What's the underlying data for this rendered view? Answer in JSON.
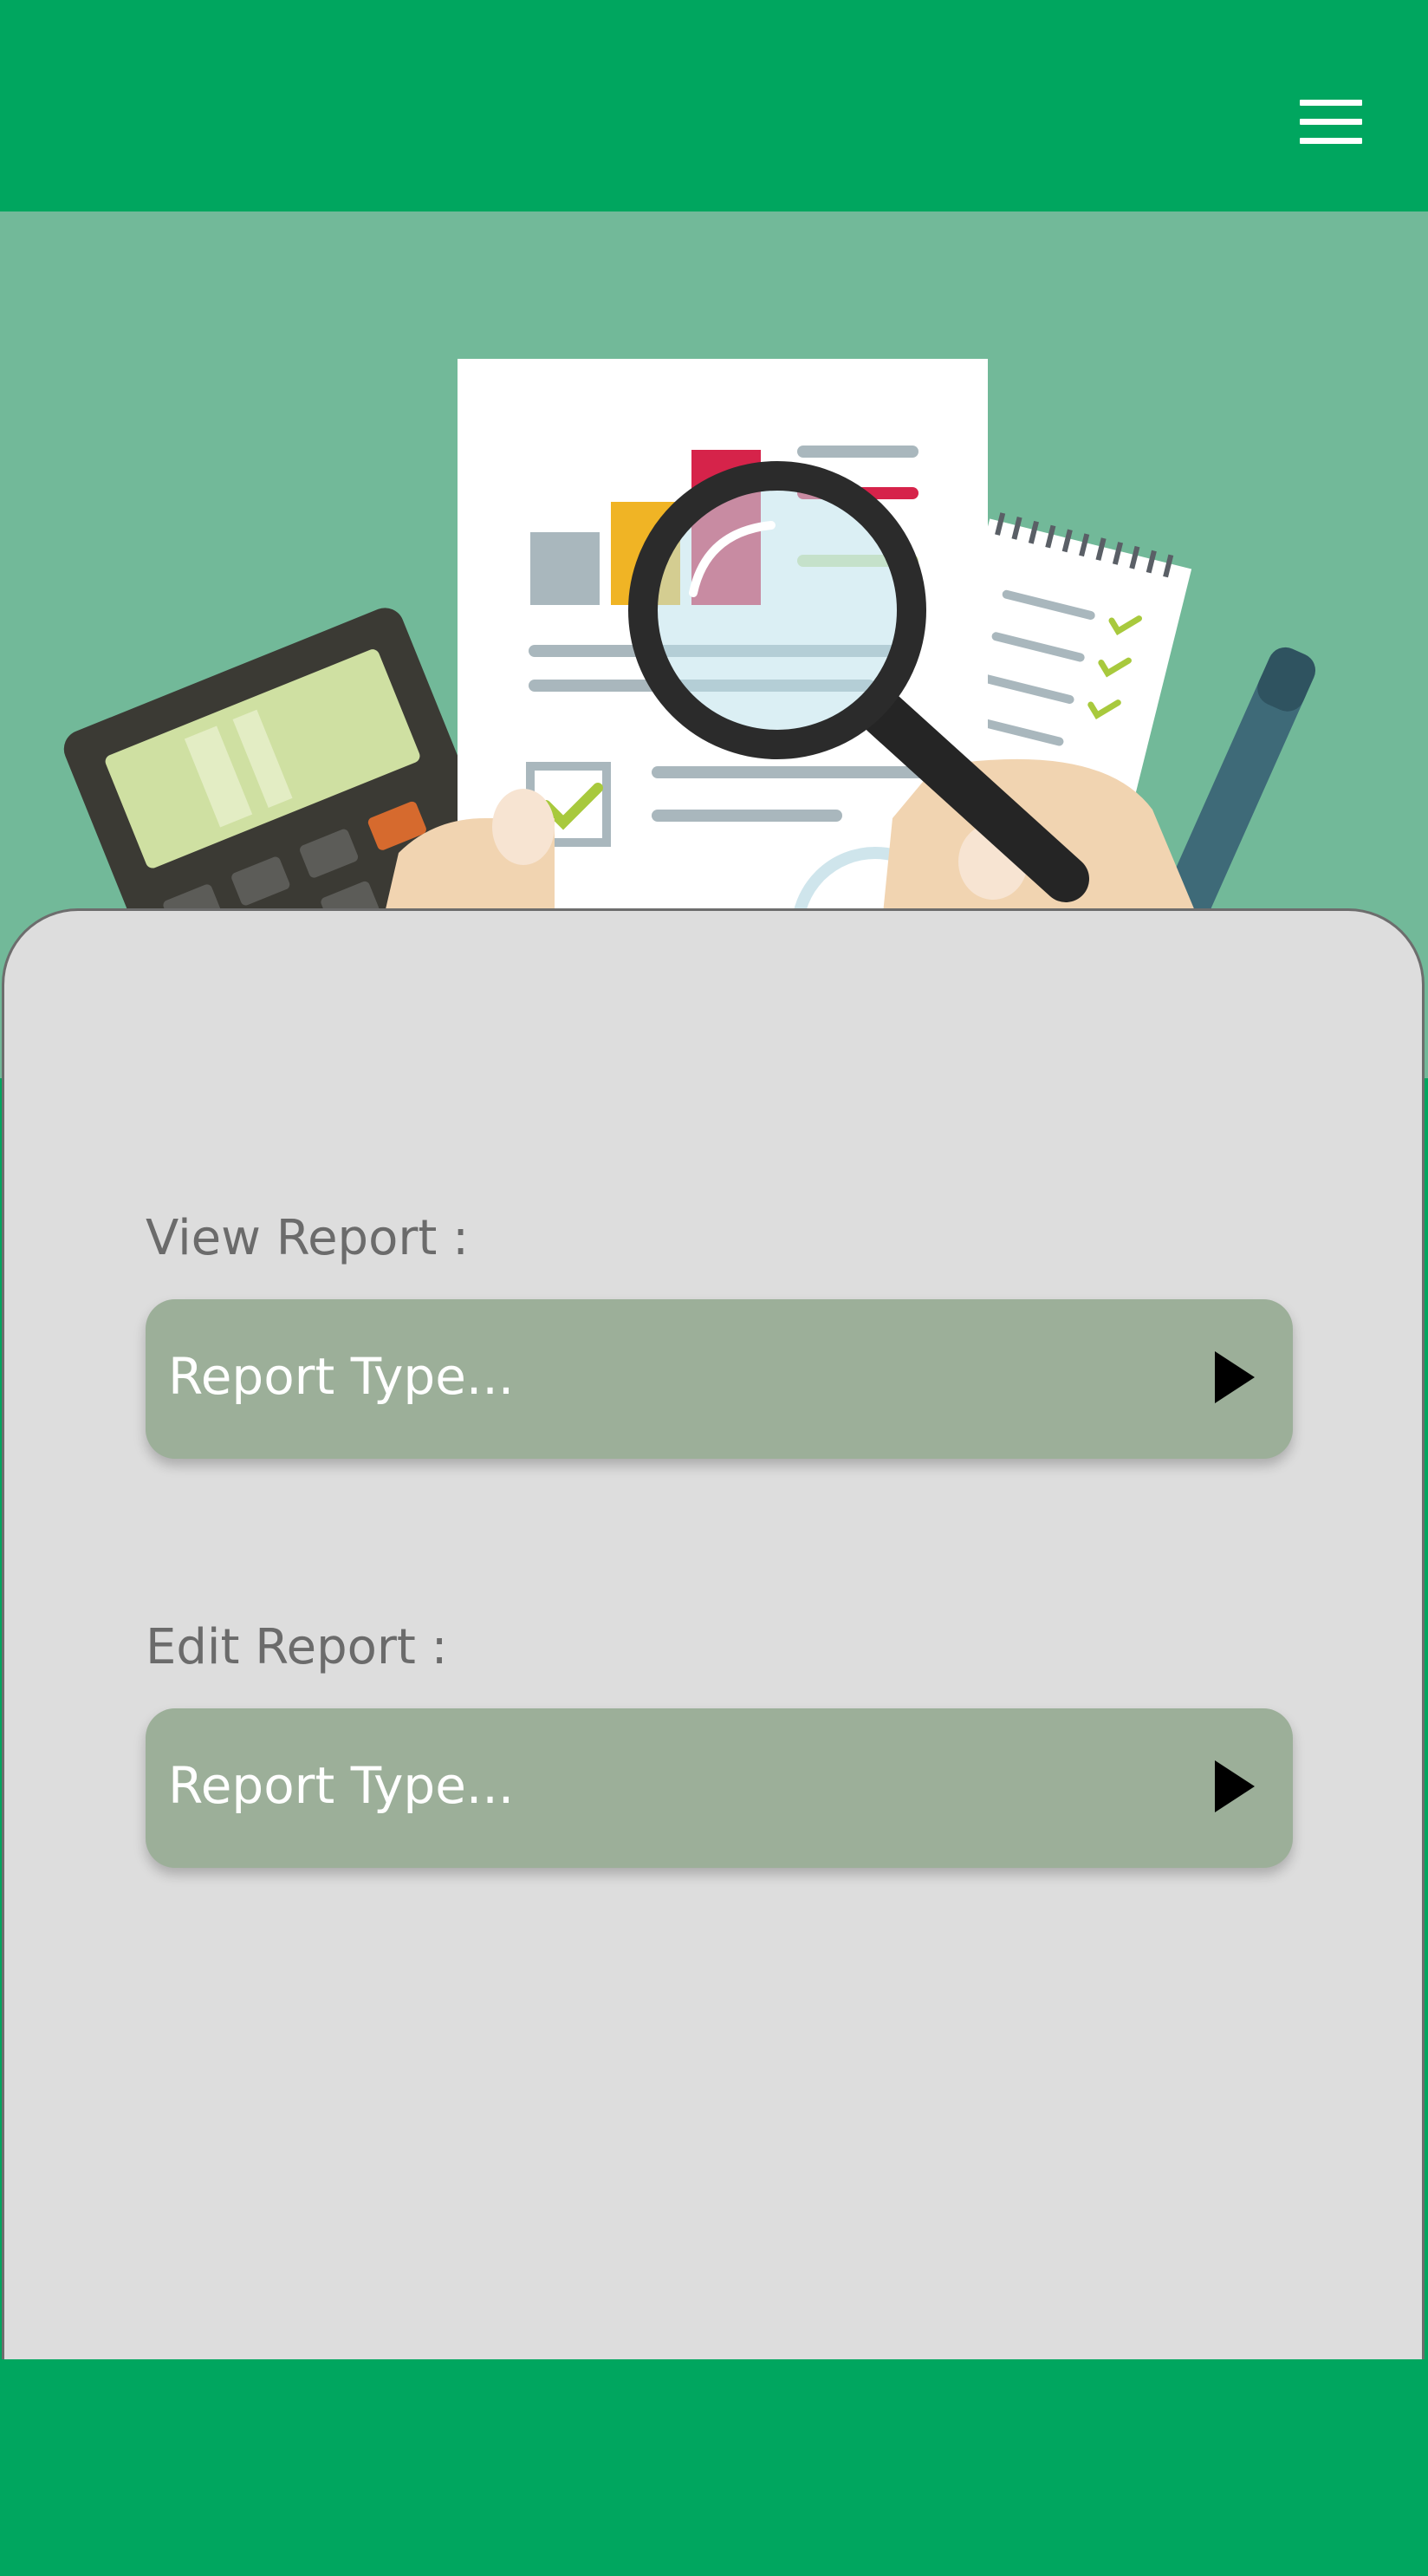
{
  "theme": {
    "accent": "#00a65f",
    "hero_background": "#72b999",
    "card_background": "#dddddd",
    "dropdown_background": "#9caf99"
  },
  "header": {
    "menu_icon": "hamburger-menu-icon"
  },
  "hero": {
    "illustration": "report-review-illustration"
  },
  "view_report": {
    "label": "View Report :",
    "dropdown_value": "Report Type...",
    "arrow_icon": "play-arrow-icon"
  },
  "edit_report": {
    "label": "Edit Report :",
    "dropdown_value": "Report Type...",
    "arrow_icon": "play-arrow-icon"
  }
}
